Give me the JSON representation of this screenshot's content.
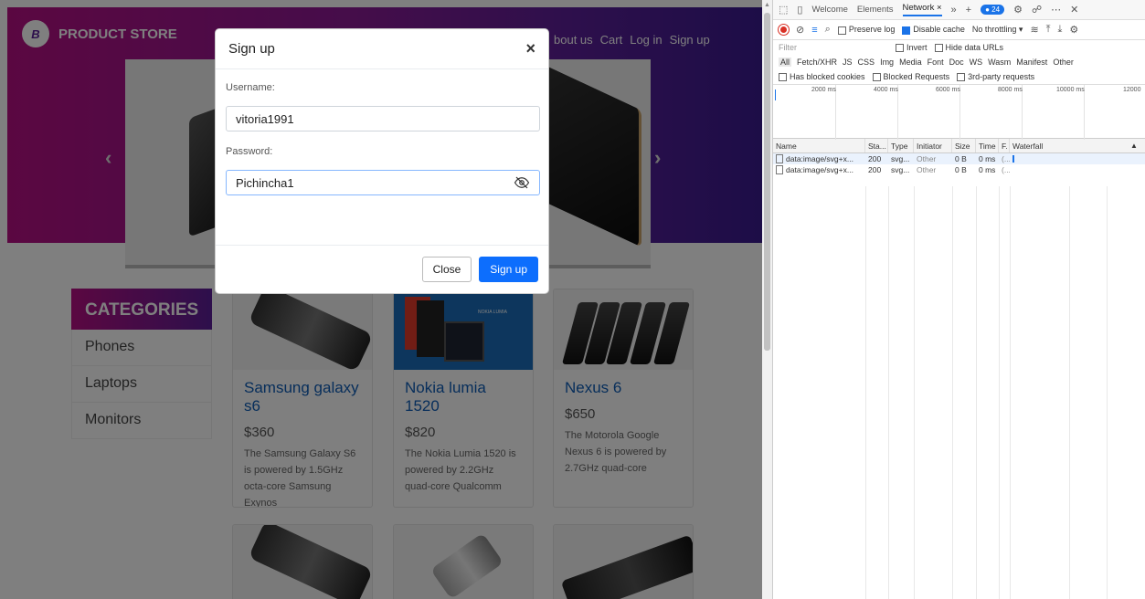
{
  "site": {
    "brand": "PRODUCT STORE",
    "brand_logo": "B",
    "nav": [
      "bout us",
      "Cart",
      "Log in",
      "Sign up"
    ],
    "categories": {
      "header": "CATEGORIES",
      "items": [
        "Phones",
        "Laptops",
        "Monitors"
      ]
    },
    "products": [
      {
        "title": "Samsung galaxy s6",
        "price": "$360",
        "desc": "The Samsung Galaxy S6 is powered by 1.5GHz octa-core Samsung Exynos"
      },
      {
        "title": "Nokia lumia 1520",
        "price": "$820",
        "desc": "The Nokia Lumia 1520 is powered by 2.2GHz quad-core Qualcomm"
      },
      {
        "title": "Nexus 6",
        "price": "$650",
        "desc": "The Motorola Google Nexus 6 is powered by 2.7GHz quad-core"
      }
    ],
    "nokia_banner": "NOKIA LUMIA"
  },
  "modal": {
    "title": "Sign up",
    "close_symbol": "×",
    "username_label": "Username:",
    "username_value": "vitoria1991",
    "password_label": "Password:",
    "password_value": "Pichincha1",
    "close_button": "Close",
    "signup_button": "Sign up"
  },
  "devtools": {
    "tabs": [
      "Welcome",
      "Elements",
      "Network"
    ],
    "issues_count": "24",
    "toolbar": {
      "preserve_log": "Preserve log",
      "disable_cache": "Disable cache",
      "throttling": "No throttling"
    },
    "filter_placeholder": "Filter",
    "invert": "Invert",
    "hide_data_urls": "Hide data URLs",
    "type_filters": [
      "All",
      "Fetch/XHR",
      "JS",
      "CSS",
      "Img",
      "Media",
      "Font",
      "Doc",
      "WS",
      "Wasm",
      "Manifest",
      "Other"
    ],
    "blocked_cookies": "Has blocked cookies",
    "blocked_requests": "Blocked Requests",
    "third_party": "3rd-party requests",
    "timeline_ticks": [
      "2000 ms",
      "4000 ms",
      "6000 ms",
      "8000 ms",
      "10000 ms",
      "12000"
    ],
    "columns": [
      "Name",
      "Sta...",
      "Type",
      "Initiator",
      "Size",
      "Time",
      "F.",
      "Waterfall"
    ],
    "rows": [
      {
        "name": "data:image/svg+x...",
        "status": "200",
        "type": "svg...",
        "initiator": "Other",
        "size": "0 B",
        "time": "0 ms",
        "f": "(..."
      },
      {
        "name": "data:image/svg+x...",
        "status": "200",
        "type": "svg...",
        "initiator": "Other",
        "size": "0 B",
        "time": "0 ms",
        "f": "(..."
      }
    ]
  }
}
